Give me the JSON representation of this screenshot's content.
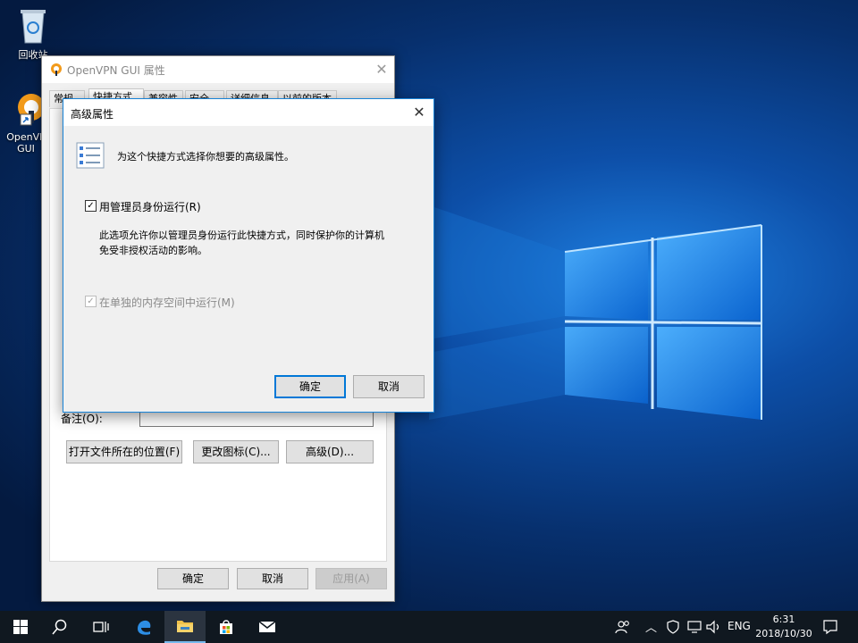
{
  "desktop": {
    "icons": [
      {
        "label": "回收站",
        "icon": "recycle-bin-icon"
      },
      {
        "label": "OpenVPN GUI",
        "label_line1": "OpenVP",
        "label_line2": "GUI",
        "icon": "openvpn-icon"
      }
    ]
  },
  "properties_window": {
    "title": "OpenVPN GUI 属性",
    "tabs": [
      "常规",
      "快捷方式",
      "兼容性",
      "安全",
      "详细信息",
      "以前的版本"
    ],
    "active_tab": "快捷方式",
    "comment_label": "备注(O):",
    "comment_value": "",
    "buttons": {
      "open_location": "打开文件所在的位置(F)",
      "change_icon": "更改图标(C)...",
      "advanced": "高级(D)...",
      "ok": "确定",
      "cancel": "取消",
      "apply": "应用(A)"
    }
  },
  "advanced_dialog": {
    "title": "高级属性",
    "header_text": "为这个快捷方式选择你想要的高级属性。",
    "run_as_admin": {
      "label": "用管理员身份运行(R)",
      "checked": true
    },
    "description_line1": "此选项允许你以管理员身份运行此快捷方式，同时保护你的计算机",
    "description_line2": "免受非授权活动的影响。",
    "separate_memory": {
      "label": "在单独的内存空间中运行(M)",
      "checked": true,
      "disabled": true
    },
    "ok_label": "确定",
    "cancel_label": "取消"
  },
  "taskbar": {
    "items": [
      "start-icon",
      "search-icon",
      "task-view-icon",
      "edge-icon",
      "file-explorer-icon",
      "store-icon",
      "mail-icon"
    ],
    "tray": {
      "language": "ENG",
      "time": "6:31",
      "date": "2018/10/30"
    }
  },
  "colors": {
    "accent": "#0078d7",
    "taskbar": "#101820"
  }
}
